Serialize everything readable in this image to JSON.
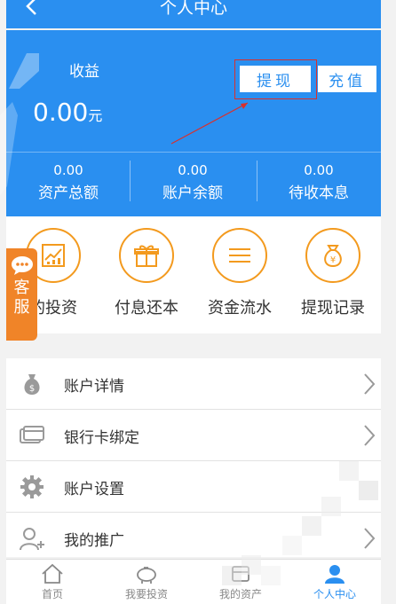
{
  "header": {
    "title": "个人中心",
    "back_icon": "chevron-left-icon"
  },
  "summary": {
    "income_label": "收益",
    "income_value": "0.00",
    "income_unit": "元",
    "withdraw_label": "提现",
    "recharge_label": "充值",
    "stats": [
      {
        "value": "0.00",
        "label": "资产总额"
      },
      {
        "value": "0.00",
        "label": "账户余额"
      },
      {
        "value": "0.00",
        "label": "待收本息"
      }
    ]
  },
  "shortcuts": [
    {
      "label": "的投资",
      "icon": "investment-chart-icon"
    },
    {
      "label": "付息还本",
      "icon": "gift-icon"
    },
    {
      "label": "资金流水",
      "icon": "list-lines-icon"
    },
    {
      "label": "提现记录",
      "icon": "money-bag-icon"
    }
  ],
  "customer_service": {
    "label_1": "客",
    "label_2": "服",
    "icon": "chat-bubble-icon"
  },
  "menu": [
    {
      "label": "账户详情",
      "icon": "money-bag-icon"
    },
    {
      "label": "银行卡绑定",
      "icon": "bank-card-icon"
    },
    {
      "label": "账户设置",
      "icon": "gear-icon"
    },
    {
      "label": "我的推广",
      "icon": "add-user-icon"
    }
  ],
  "nav": [
    {
      "label": "首页",
      "icon": "home-icon"
    },
    {
      "label": "我要投资",
      "icon": "piggy-bank-icon"
    },
    {
      "label": "我的资产",
      "icon": "assets-icon"
    },
    {
      "label": "个人中心",
      "icon": "user-icon",
      "active": true
    }
  ],
  "colors": {
    "primary": "#2a8ff0",
    "accent": "#f39a1e",
    "cs_tab": "#f08428",
    "highlight": "#d9302c"
  }
}
